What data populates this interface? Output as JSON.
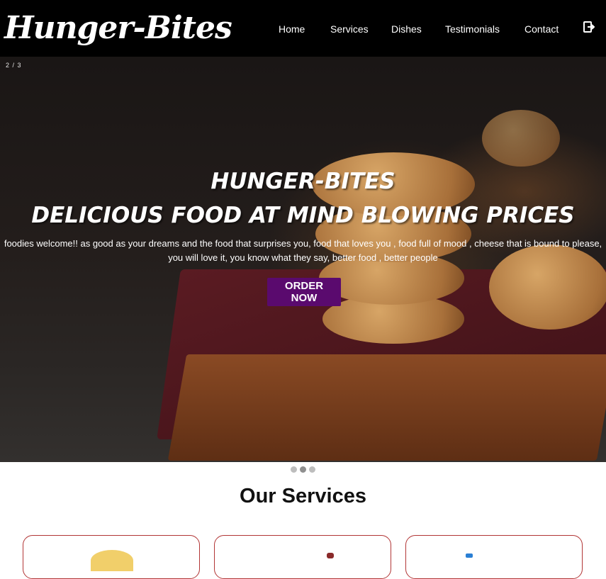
{
  "brand": {
    "logo_text": "Hunger-Bites"
  },
  "nav": {
    "items": [
      {
        "label": "Home"
      },
      {
        "label": "Services"
      },
      {
        "label": "Dishes"
      },
      {
        "label": "Testimonials"
      },
      {
        "label": "Contact"
      }
    ],
    "logout_icon": "logout-icon"
  },
  "hero": {
    "slide_counter": "2 / 3",
    "title_line1": "HUNGER-BITES",
    "title_line2": "DELICIOUS FOOD AT MIND BLOWING PRICES",
    "text_line1": "foodies welcome!! as good as your dreams and the food that surprises you, food that loves you , food full of mood , cheese that is bound to please,",
    "text_line2": "you will love it, you know what they say, better food , better people",
    "button_label": "ORDER NOW",
    "button_color": "#5a0a6e"
  },
  "carousel": {
    "dot_count": 3,
    "active_dot": 2
  },
  "services": {
    "heading": "Our Services",
    "card_border_color": "#b23636"
  }
}
